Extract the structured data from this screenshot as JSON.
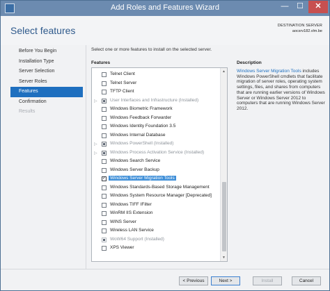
{
  "window": {
    "title": "Add Roles and Features Wizard",
    "min": "—",
    "max": "☐",
    "close": "✕"
  },
  "header": {
    "page_title": "Select features",
    "destination_label": "DESTINATION SERVER",
    "destination_server": "aocsrv182.vlm.be"
  },
  "nav": {
    "items": [
      {
        "label": "Before You Begin"
      },
      {
        "label": "Installation Type"
      },
      {
        "label": "Server Selection"
      },
      {
        "label": "Server Roles"
      },
      {
        "label": "Features"
      },
      {
        "label": "Confirmation"
      },
      {
        "label": "Results"
      }
    ]
  },
  "main": {
    "intro": "Select one or more features to install on the selected server.",
    "features_label": "Features",
    "features": [
      {
        "label": "Telnet Client",
        "state": "unchecked"
      },
      {
        "label": "Telnet Server",
        "state": "unchecked"
      },
      {
        "label": "TFTP Client",
        "state": "unchecked"
      },
      {
        "label": "User Interfaces and Infrastructure (Installed)",
        "state": "partial"
      },
      {
        "label": "Windows Biometric Framework",
        "state": "unchecked"
      },
      {
        "label": "Windows Feedback Forwarder",
        "state": "unchecked"
      },
      {
        "label": "Windows Identity Foundation 3.5",
        "state": "unchecked"
      },
      {
        "label": "Windows Internal Database",
        "state": "unchecked"
      },
      {
        "label": "Windows PowerShell (Installed)",
        "state": "partial"
      },
      {
        "label": "Windows Process Activation Service (Installed)",
        "state": "partial"
      },
      {
        "label": "Windows Search Service",
        "state": "unchecked"
      },
      {
        "label": "Windows Server Backup",
        "state": "unchecked"
      },
      {
        "label": "Windows Server Migration Tools",
        "state": "checked"
      },
      {
        "label": "Windows Standards-Based Storage Management",
        "state": "unchecked"
      },
      {
        "label": "Windows System Resource Manager [Deprecated]",
        "state": "unchecked"
      },
      {
        "label": "Windows TIFF IFilter",
        "state": "unchecked"
      },
      {
        "label": "WinRM IIS Extension",
        "state": "unchecked"
      },
      {
        "label": "WINS Server",
        "state": "unchecked"
      },
      {
        "label": "Wireless LAN Service",
        "state": "unchecked"
      },
      {
        "label": "WoW64 Support (Installed)",
        "state": "disabled"
      },
      {
        "label": "XPS Viewer",
        "state": "unchecked"
      }
    ],
    "scroll_up": "▲",
    "scroll_down": "▼"
  },
  "description": {
    "label": "Description",
    "link": "Windows Server Migration Tools",
    "text": "includes Windows PowerShell cmdlets that facilitate migration of server roles, operating system settings, files, and shares from computers that are running earlier versions of Windows Server or Windows Server 2012 to computers that are running Windows Server 2012."
  },
  "footer": {
    "previous": "< Previous",
    "next": "Next >",
    "install": "Install",
    "cancel": "Cancel"
  },
  "colors": {
    "accent": "#1e6fbf",
    "titlebar": "#6c8bb0",
    "selection": "#3f8fd8"
  }
}
